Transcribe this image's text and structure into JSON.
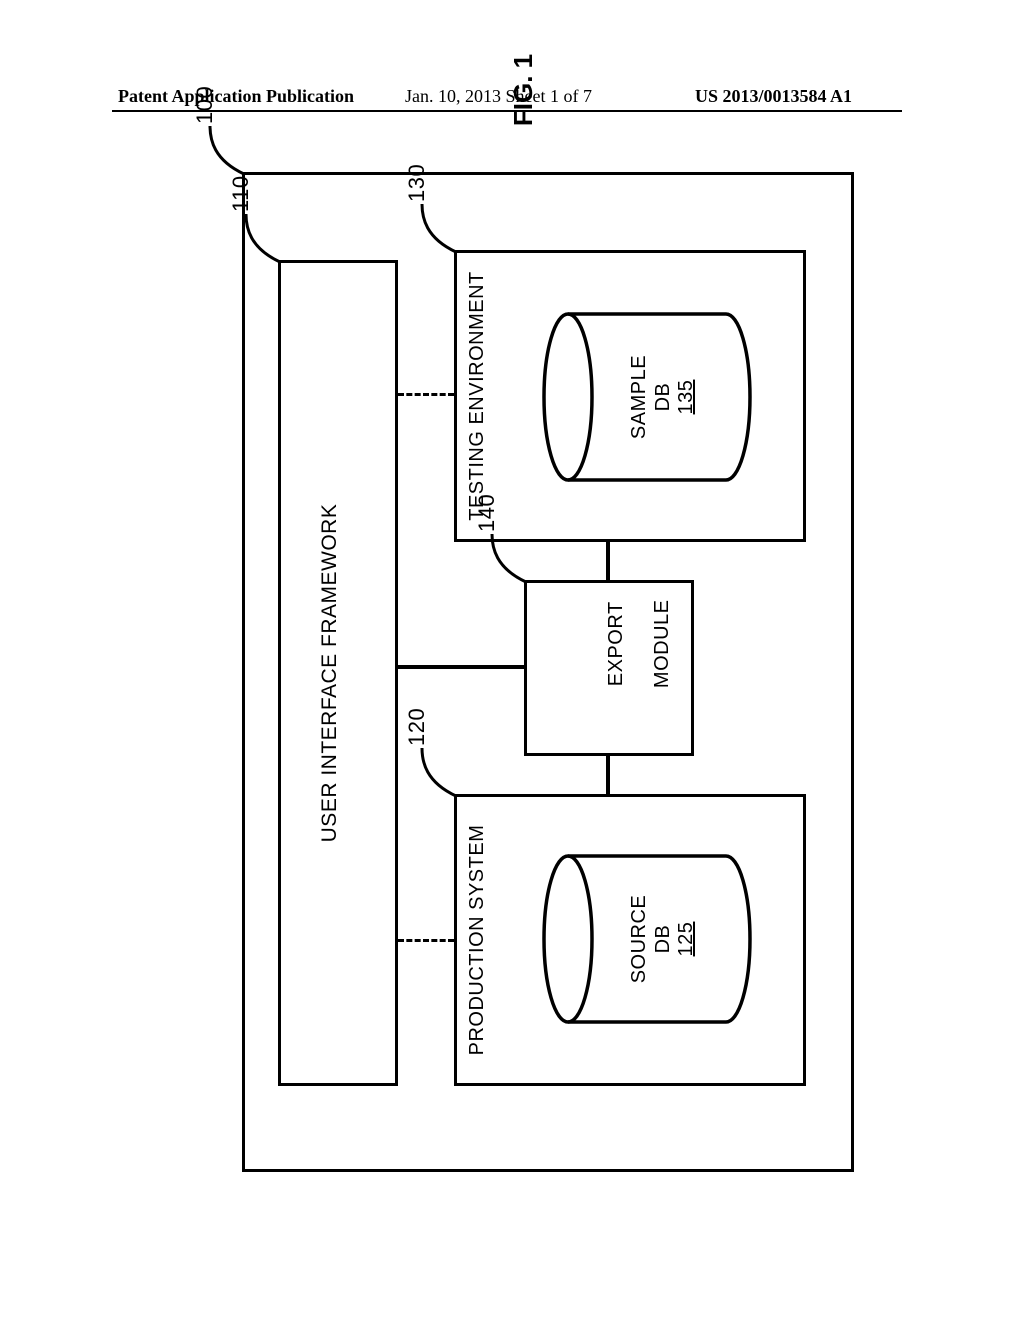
{
  "header": {
    "left": "Patent Application Publication",
    "middle": "Jan. 10, 2013  Sheet 1 of 7",
    "right": "US 2013/0013584 A1"
  },
  "fig_label": "FIG. 1",
  "refs": {
    "outer": "100",
    "ui": "110",
    "prod": "120",
    "source_db": "125",
    "test": "130",
    "sample_db": "135",
    "export": "140"
  },
  "labels": {
    "ui_framework": "USER INTERFACE FRAMEWORK",
    "production_system": "PRODUCTION SYSTEM",
    "testing_environment": "TESTING ENVIRONMENT",
    "export_module_1": "EXPORT",
    "export_module_2": "MODULE",
    "source_db_1": "SOURCE",
    "source_db_2": "DB",
    "sample_db_1": "SAMPLE",
    "sample_db_2": "DB"
  }
}
